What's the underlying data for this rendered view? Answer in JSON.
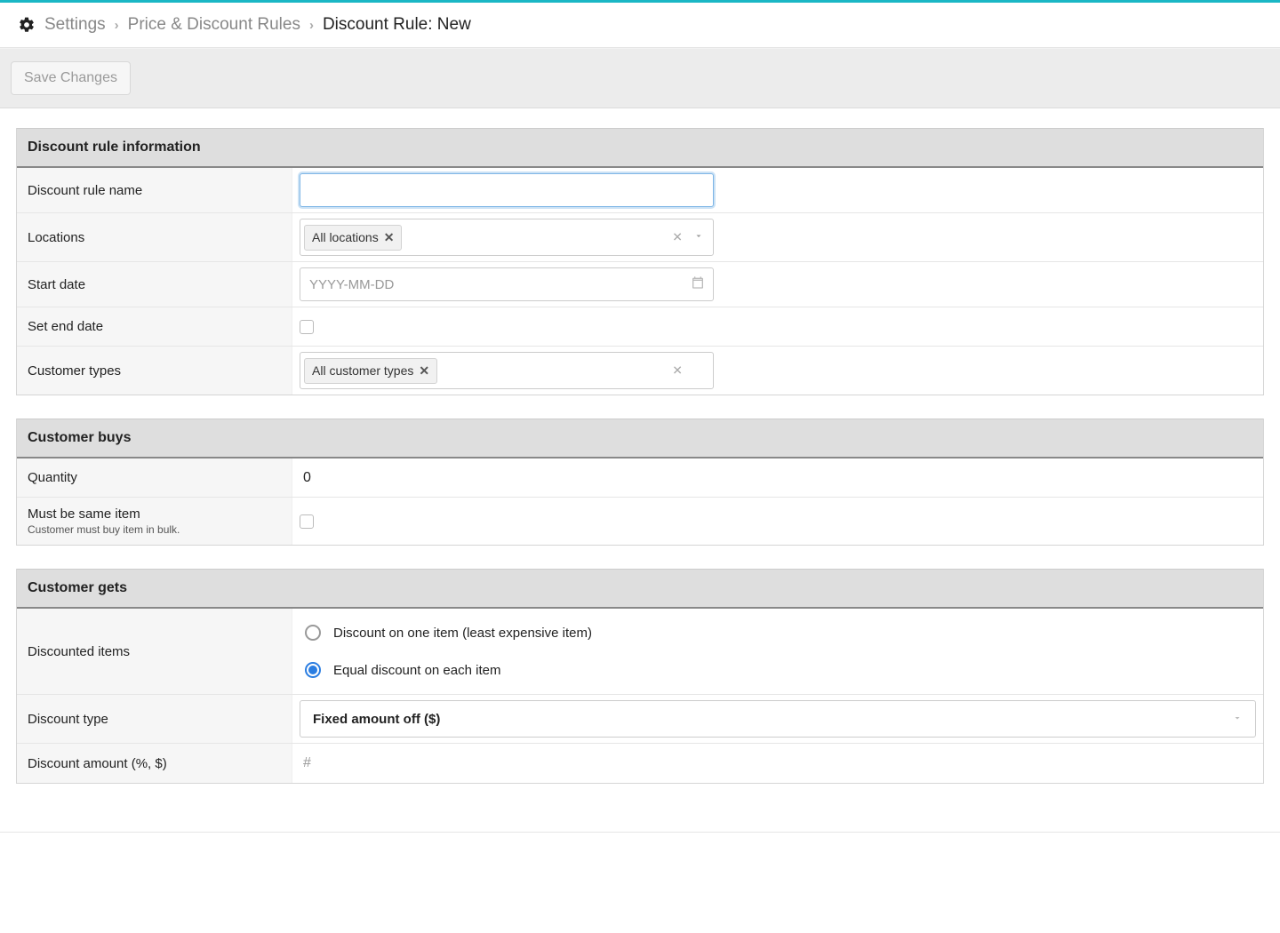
{
  "breadcrumb": {
    "settings": "Settings",
    "pricerules": "Price & Discount Rules",
    "current": "Discount Rule: New"
  },
  "toolbar": {
    "save_label": "Save Changes"
  },
  "sections": {
    "info": {
      "title": "Discount rule information",
      "name_label": "Discount rule name",
      "name_value": "",
      "locations_label": "Locations",
      "locations_tag": "All locations",
      "startdate_label": "Start date",
      "startdate_placeholder": "YYYY-MM-DD",
      "setenddate_label": "Set end date",
      "custtypes_label": "Customer types",
      "custtypes_tag": "All customer types"
    },
    "buys": {
      "title": "Customer buys",
      "qty_label": "Quantity",
      "qty_value": "0",
      "sameitem_label": "Must be same item",
      "sameitem_sub": "Customer must buy item in bulk."
    },
    "gets": {
      "title": "Customer gets",
      "disc_items_label": "Discounted items",
      "radio_one": "Discount on one item (least expensive item)",
      "radio_each": "Equal discount on each item",
      "disc_type_label": "Discount type",
      "disc_type_value": "Fixed amount off ($)",
      "disc_amount_label": "Discount amount (%, $)",
      "disc_amount_placeholder": "#"
    }
  }
}
